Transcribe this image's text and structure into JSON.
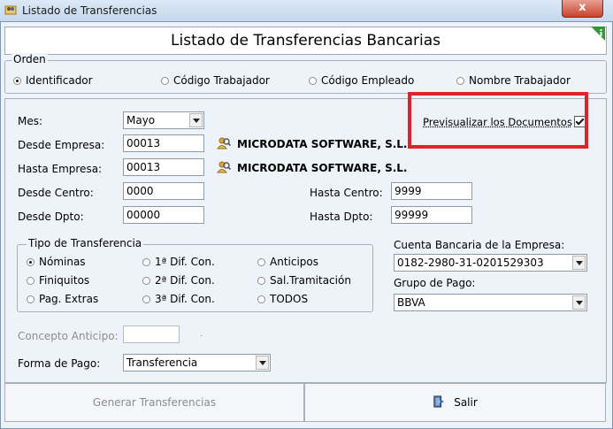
{
  "window": {
    "title": "Listado de Transferencias",
    "close_glyph": "x"
  },
  "header": {
    "title": "Listado de Transferencias Bancarias"
  },
  "orden": {
    "legend": "Orden",
    "options": [
      {
        "label": "Identificador",
        "selected": true
      },
      {
        "label": "Código Trabajador",
        "selected": false
      },
      {
        "label": "Código Empleado",
        "selected": false
      },
      {
        "label": "Nombre Trabajador",
        "selected": false
      }
    ]
  },
  "form": {
    "mes_label": "Mes:",
    "mes_value": "Mayo",
    "desde_empresa_label": "Desde Empresa:",
    "desde_empresa_value": "00013",
    "desde_empresa_name": "MICRODATA SOFTWARE, S.L.",
    "hasta_empresa_label": "Hasta Empresa:",
    "hasta_empresa_value": "00013",
    "hasta_empresa_name": "MICRODATA SOFTWARE, S.L.",
    "desde_centro_label": "Desde Centro:",
    "desde_centro_value": "0000",
    "hasta_centro_label": "Hasta Centro:",
    "hasta_centro_value": "9999",
    "desde_dpto_label": "Desde Dpto:",
    "desde_dpto_value": "00000",
    "hasta_dpto_label": "Hasta Dpto:",
    "hasta_dpto_value": "99999",
    "previsualizar_label": "Previsualizar los Documentos",
    "previsualizar_checked": true
  },
  "tipo_transferencia": {
    "legend": "Tipo de Transferencia",
    "options": [
      {
        "label": "Nóminas",
        "selected": true
      },
      {
        "label": "1ª Dif. Con.",
        "selected": false
      },
      {
        "label": "Anticipos",
        "selected": false
      },
      {
        "label": "Finiquitos",
        "selected": false
      },
      {
        "label": "2ª Dif. Con.",
        "selected": false
      },
      {
        "label": "Sal.Tramitación",
        "selected": false
      },
      {
        "label": "Pag. Extras",
        "selected": false
      },
      {
        "label": "3ª Dif. Con.",
        "selected": false
      },
      {
        "label": "TODOS",
        "selected": false
      }
    ]
  },
  "cuenta": {
    "label": "Cuenta Bancaria de la Empresa:",
    "value": "0182-2980-31-0201529303"
  },
  "grupo": {
    "label": "Grupo de Pago:",
    "value": "BBVA"
  },
  "concepto": {
    "label": "Concepto Anticipo:",
    "value": "",
    "dot": "."
  },
  "forma_pago": {
    "label": "Forma de Pago:",
    "value": "Transferencia"
  },
  "buttons": {
    "generar": "Generar Transferencias",
    "salir": "Salir"
  },
  "colors": {
    "highlight": "#e0232b",
    "frame_bg": "#eef3fa",
    "info_green": "#2e9a3a"
  }
}
